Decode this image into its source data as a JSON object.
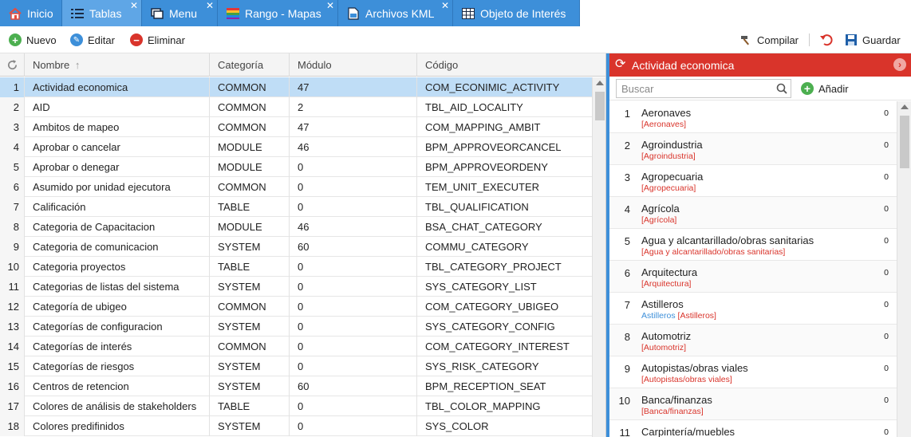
{
  "tabs": [
    {
      "label": "Inicio",
      "icon": "home-icon",
      "closable": false
    },
    {
      "label": "Tablas",
      "icon": "table-list-icon",
      "closable": true,
      "active": true
    },
    {
      "label": "Menu",
      "icon": "window-icon",
      "closable": true
    },
    {
      "label": "Rango - Mapas",
      "icon": "rainbow-icon",
      "closable": true
    },
    {
      "label": "Archivos KML",
      "icon": "file-icon",
      "closable": true
    },
    {
      "label": "Objeto de Interés",
      "icon": "grid-icon",
      "closable": false
    }
  ],
  "toolbar": {
    "new_label": "Nuevo",
    "edit_label": "Editar",
    "delete_label": "Eliminar",
    "compile_label": "Compilar",
    "save_label": "Guardar"
  },
  "grid": {
    "columns": {
      "name": "Nombre",
      "category": "Categoría",
      "module": "Módulo",
      "code": "Código"
    },
    "sort_indicator": "↑",
    "rows": [
      {
        "n": "1",
        "name": "Actividad economica",
        "category": "COMMON",
        "module": "47",
        "code": "COM_ECONIMIC_ACTIVITY"
      },
      {
        "n": "2",
        "name": "AID",
        "category": "COMMON",
        "module": "2",
        "code": "TBL_AID_LOCALITY"
      },
      {
        "n": "3",
        "name": "Ambitos de mapeo",
        "category": "COMMON",
        "module": "47",
        "code": "COM_MAPPING_AMBIT"
      },
      {
        "n": "4",
        "name": "Aprobar o cancelar",
        "category": "MODULE",
        "module": "46",
        "code": "BPM_APPROVEORCANCEL"
      },
      {
        "n": "5",
        "name": "Aprobar o denegar",
        "category": "MODULE",
        "module": "0",
        "code": "BPM_APPROVEORDENY"
      },
      {
        "n": "6",
        "name": "Asumido por unidad ejecutora",
        "category": "COMMON",
        "module": "0",
        "code": "TEM_UNIT_EXECUTER"
      },
      {
        "n": "7",
        "name": "Calificación",
        "category": "TABLE",
        "module": "0",
        "code": "TBL_QUALIFICATION"
      },
      {
        "n": "8",
        "name": "Categoria de Capacitacion",
        "category": "MODULE",
        "module": "46",
        "code": "BSA_CHAT_CATEGORY"
      },
      {
        "n": "9",
        "name": "Categoria de comunicacion",
        "category": "SYSTEM",
        "module": "60",
        "code": "COMMU_CATEGORY"
      },
      {
        "n": "10",
        "name": "Categoria proyectos",
        "category": "TABLE",
        "module": "0",
        "code": "TBL_CATEGORY_PROJECT"
      },
      {
        "n": "11",
        "name": "Categorias de listas del sistema",
        "category": "SYSTEM",
        "module": "0",
        "code": "SYS_CATEGORY_LIST"
      },
      {
        "n": "12",
        "name": "Categoría de ubigeo",
        "category": "COMMON",
        "module": "0",
        "code": "COM_CATEGORY_UBIGEO"
      },
      {
        "n": "13",
        "name": "Categorías de configuracion",
        "category": "SYSTEM",
        "module": "0",
        "code": "SYS_CATEGORY_CONFIG"
      },
      {
        "n": "14",
        "name": "Categorías de interés",
        "category": "COMMON",
        "module": "0",
        "code": "COM_CATEGORY_INTEREST"
      },
      {
        "n": "15",
        "name": "Categorías de riesgos",
        "category": "SYSTEM",
        "module": "0",
        "code": "SYS_RISK_CATEGORY"
      },
      {
        "n": "16",
        "name": "Centros de retencion",
        "category": "SYSTEM",
        "module": "60",
        "code": "BPM_RECEPTION_SEAT"
      },
      {
        "n": "17",
        "name": "Colores de análisis de stakeholders",
        "category": "TABLE",
        "module": "0",
        "code": "TBL_COLOR_MAPPING"
      },
      {
        "n": "18",
        "name": "Colores predifinidos",
        "category": "SYSTEM",
        "module": "0",
        "code": "SYS_COLOR"
      }
    ]
  },
  "panel": {
    "title": "Actividad economica",
    "search_placeholder": "Buscar",
    "add_label": "Añadir",
    "items": [
      {
        "n": "1",
        "name": "Aeronaves",
        "sub": "[Aeronaves]",
        "count": "0"
      },
      {
        "n": "2",
        "name": "Agroindustria",
        "sub": "[Agroindustria]",
        "count": "0"
      },
      {
        "n": "3",
        "name": "Agropecuaria",
        "sub": "[Agropecuaria]",
        "count": "0"
      },
      {
        "n": "4",
        "name": "Agrícola",
        "sub": "[Agrícola]",
        "count": "0"
      },
      {
        "n": "5",
        "name": "Agua y alcantarillado/obras sanitarias",
        "sub": "[Agua y alcantarillado/obras sanitarias]",
        "count": "0"
      },
      {
        "n": "6",
        "name": "Arquitectura",
        "sub": "[Arquitectura]",
        "count": "0"
      },
      {
        "n": "7",
        "name": "Astilleros",
        "sub_prefix": "Astilleros",
        "sub": "[Astilleros]",
        "count": "0"
      },
      {
        "n": "8",
        "name": "Automotriz",
        "sub": "[Automotriz]",
        "count": "0"
      },
      {
        "n": "9",
        "name": "Autopistas/obras viales",
        "sub": "[Autopistas/obras viales]",
        "count": "0"
      },
      {
        "n": "10",
        "name": "Banca/finanzas",
        "sub": "[Banca/finanzas]",
        "count": "0"
      },
      {
        "n": "11",
        "name": "Carpintería/muebles",
        "sub": "",
        "count": "0"
      }
    ]
  },
  "colors": {
    "accent": "#3d8fd9",
    "panel_header": "#d9342b",
    "selected_row": "#bfddf6",
    "add_green": "#4caf50"
  }
}
